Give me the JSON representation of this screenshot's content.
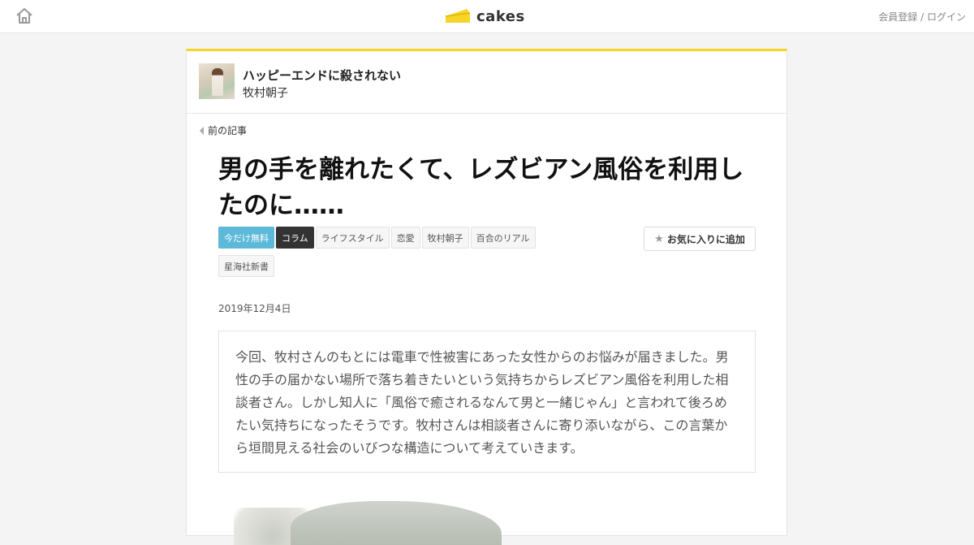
{
  "header": {
    "home_icon": "home-icon",
    "logo_text": "cakes",
    "logo_color": "#f7d528",
    "auth_register": "会員登録",
    "auth_separator": " / ",
    "auth_login": "ログイン"
  },
  "series": {
    "title": "ハッピーエンドに殺されない",
    "author": "牧村朝子"
  },
  "nav": {
    "prev_label": "前の記事"
  },
  "article": {
    "title": "男の手を離れたくて、レズビアン風俗を利用したのに……",
    "tags": [
      {
        "label": "今だけ無料",
        "kind": "free"
      },
      {
        "label": "コラム",
        "kind": "column"
      },
      {
        "label": "ライフスタイル",
        "kind": "normal"
      },
      {
        "label": "恋愛",
        "kind": "normal"
      },
      {
        "label": "牧村朝子",
        "kind": "normal"
      },
      {
        "label": "百合のリアル",
        "kind": "normal"
      },
      {
        "label": "星海社新書",
        "kind": "normal"
      }
    ],
    "favorite_label": "お気に入りに追加",
    "date": "2019年12月4日",
    "lead": "今回、牧村さんのもとには電車で性被害にあった女性からのお悩みが届きました。男性の手の届かない場所で落ち着きたいという気持ちからレズビアン風俗を利用した相談者さん。しかし知人に「風俗で癒されるなんて男と一緒じゃん」と言われて後ろめたい気持ちになったそうです。牧村さんは相談者さんに寄り添いながら、この言葉から垣間見える社会のいびつな構造について考えていきます。"
  },
  "colors": {
    "accent": "#f7d528",
    "free_tag": "#5db9d9",
    "column_tag": "#333333"
  }
}
